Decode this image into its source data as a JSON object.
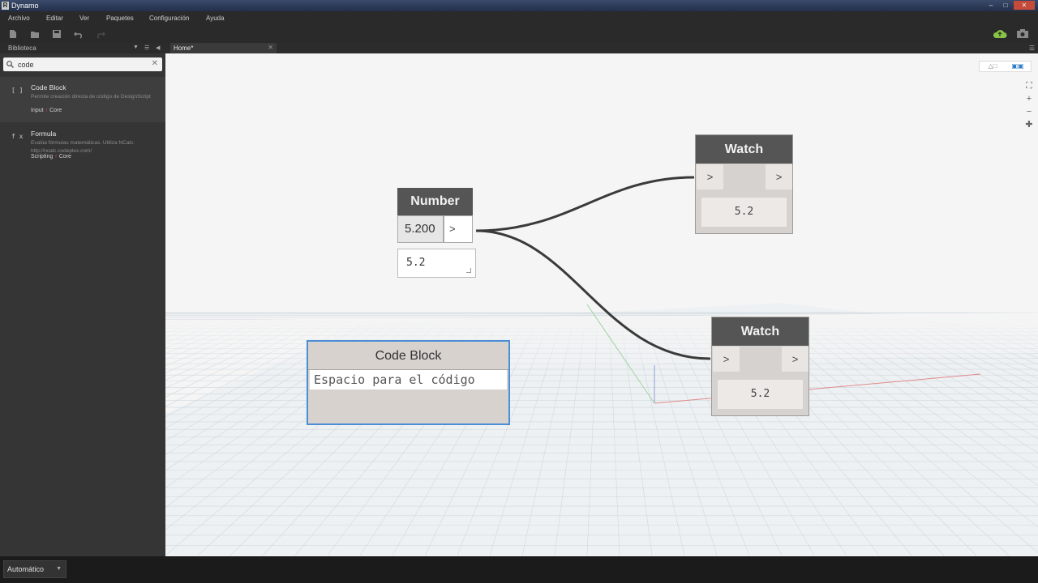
{
  "window": {
    "title": "Dynamo",
    "app_icon_letter": "R"
  },
  "menu": {
    "items": [
      "Archivo",
      "Editar",
      "Ver",
      "Paquetes",
      "Configuración",
      "Ayuda"
    ]
  },
  "toolbar": {
    "icons": [
      "new-file-icon",
      "open-file-icon",
      "save-icon",
      "undo-icon",
      "redo-icon"
    ],
    "right_icons": [
      "cloud-upload-icon",
      "camera-icon"
    ],
    "cloud_color": "#8bc34a"
  },
  "library": {
    "title": "Biblioteca",
    "search": {
      "value": "code",
      "placeholder": ""
    },
    "results": [
      {
        "icon": "[ ]",
        "name": "Code Block",
        "description": "Permite creación directa de código de DesignScript",
        "category": "Input",
        "subcategory": "Core"
      },
      {
        "icon": "f x",
        "name": "Formula",
        "description": "Evalúa fórmulas matemáticas. Utiliza NCalc: http://ncalc.codeplex.com/",
        "category": "Scripting",
        "subcategory": "Core"
      }
    ]
  },
  "tabs": [
    {
      "label": "Home*"
    }
  ],
  "canvas": {
    "nodes": {
      "number": {
        "title": "Number",
        "value": "5.200",
        "output": ">",
        "preview": "5.2"
      },
      "watch_top": {
        "title": "Watch",
        "input": ">",
        "output": ">",
        "value": "5.2"
      },
      "watch_bottom": {
        "title": "Watch",
        "input": ">",
        "output": ">",
        "value": "5.2"
      },
      "code_block": {
        "title": "Code Block",
        "placeholder": "Espacio para el código"
      }
    },
    "accent_selected": "#4a8fd6",
    "wire_color": "#3a3a3a",
    "controls": [
      "zoom-to-fit-icon",
      "zoom-in-icon",
      "zoom-out-icon",
      "pan-icon"
    ]
  },
  "status": {
    "run_mode": "Automático"
  }
}
